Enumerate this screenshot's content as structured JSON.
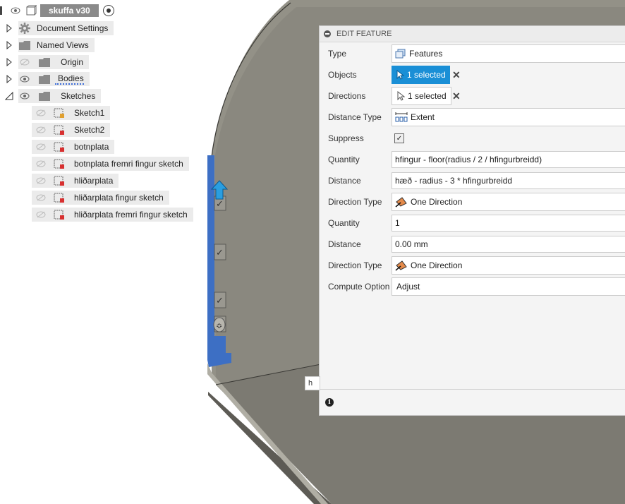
{
  "tree": {
    "root_label": "skuffa v30",
    "items": [
      {
        "label": "Document Settings"
      },
      {
        "label": "Named Views"
      },
      {
        "label": "Origin"
      },
      {
        "label": "Bodies"
      },
      {
        "label": "Sketches"
      }
    ],
    "sketches": [
      {
        "label": "Sketch1"
      },
      {
        "label": "Sketch2"
      },
      {
        "label": "botnplata"
      },
      {
        "label": "botnplata fremri fingur sketch"
      },
      {
        "label": "hliðarplata"
      },
      {
        "label": "hliðarplata fingur sketch"
      },
      {
        "label": "hliðarplata fremri fingur sketch"
      }
    ]
  },
  "dialog": {
    "title": "EDIT FEATURE",
    "rows": {
      "type": {
        "label": "Type",
        "value": "Features"
      },
      "objects": {
        "label": "Objects",
        "value": "1 selected"
      },
      "directions": {
        "label": "Directions",
        "value": "1 selected"
      },
      "distance_type": {
        "label": "Distance Type",
        "value": "Extent"
      },
      "suppress": {
        "label": "Suppress",
        "checked": true
      },
      "quantity1": {
        "label": "Quantity",
        "value": "hfingur - floor(radius / 2 / hfingurbreidd)"
      },
      "distance1": {
        "label": "Distance",
        "value": "hæð - radius - 3 * hfingurbreidd"
      },
      "direction_type1": {
        "label": "Direction Type",
        "value": "One Direction"
      },
      "quantity2": {
        "label": "Quantity",
        "value": "1"
      },
      "distance2": {
        "label": "Distance",
        "value": "0.00 mm"
      },
      "direction_type2": {
        "label": "Direction Type",
        "value": "One Direction"
      },
      "compute": {
        "label": "Compute Option",
        "value": "Adjust"
      }
    }
  },
  "tooltip_fragment": "h",
  "colors": {
    "accent": "#1a8fd6",
    "model_face": "#8c8a80",
    "model_dark": "#6e6c64",
    "selection_blue": "#3d6fc4"
  }
}
